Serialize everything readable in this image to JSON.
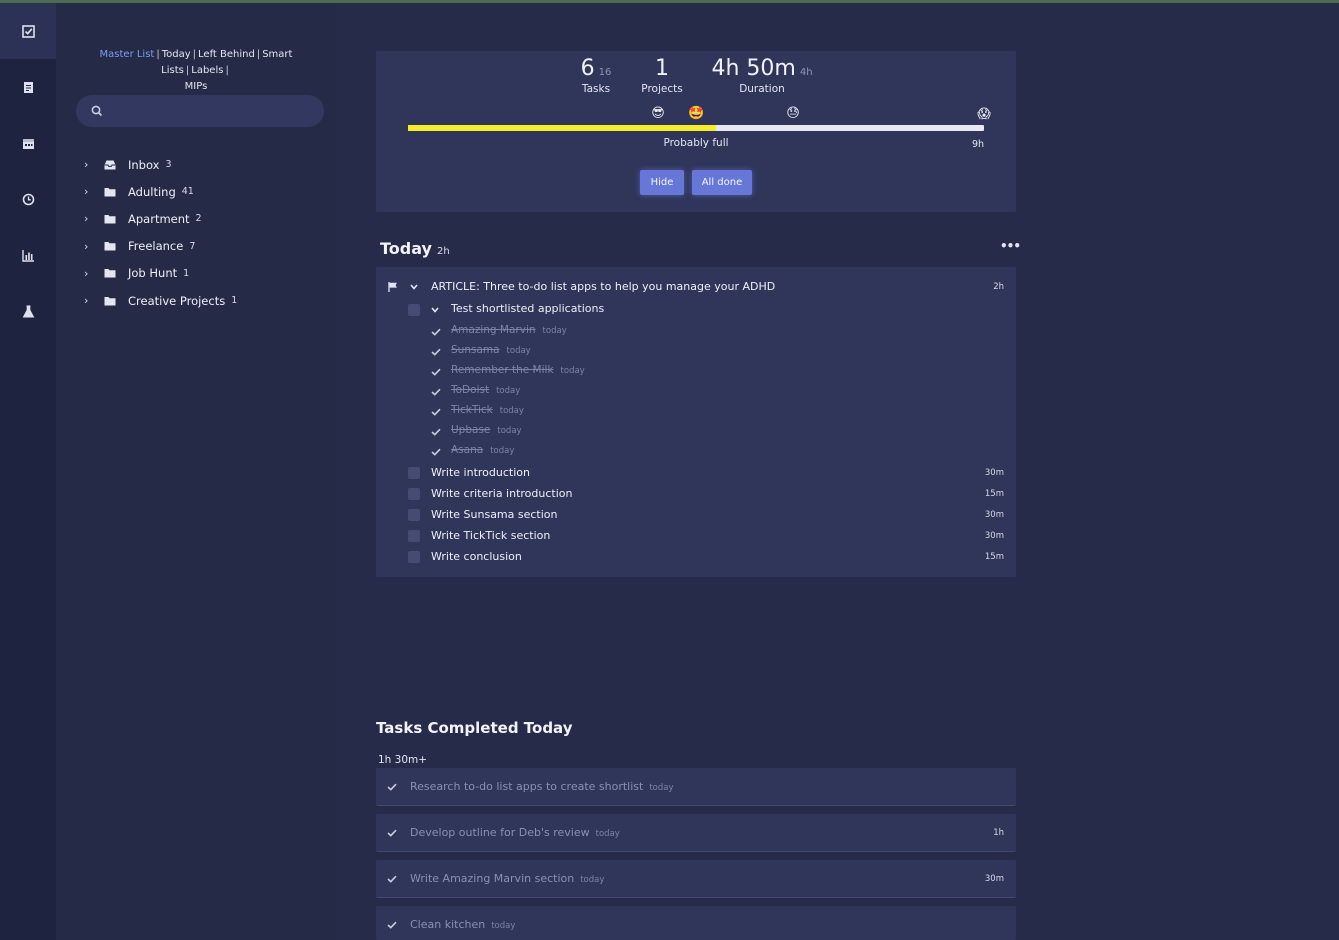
{
  "nav": {
    "links": [
      "Master List",
      "Today",
      "Left Behind",
      "Smart Lists",
      "Labels"
    ],
    "extra": "MIPs",
    "separator": "|"
  },
  "search": {
    "placeholder": ""
  },
  "folders": [
    {
      "name": "Inbox",
      "count": "3",
      "icon": "inbox-icon"
    },
    {
      "name": "Adulting",
      "count": "41",
      "icon": "folder-icon"
    },
    {
      "name": "Apartment",
      "count": "2",
      "icon": "folder-icon"
    },
    {
      "name": "Freelance",
      "count": "7",
      "icon": "folder-icon"
    },
    {
      "name": "Job Hunt",
      "count": "1",
      "icon": "folder-icon"
    },
    {
      "name": "Creative Projects",
      "count": "1",
      "icon": "folder-icon"
    }
  ],
  "summary": {
    "tasks_value": "6",
    "tasks_total": "16",
    "tasks_label": "Tasks",
    "projects_value": "1",
    "projects_label": "Projects",
    "duration_value": "4h 50m",
    "duration_extra": "4h",
    "duration_label": "Duration",
    "progress_fraction": 0.535,
    "capacity_label": "Probably full",
    "capacity_end": "9h",
    "hide_label": "Hide",
    "all_done_label": "All done",
    "emojis": [
      "😎",
      "🤩",
      "😓",
      "😱"
    ]
  },
  "today": {
    "title": "Today",
    "duration": "2h",
    "more": "•••",
    "project": {
      "title": "ARTICLE: Three to-do list apps to help you manage your ADHD",
      "time": "2h"
    },
    "subgroup": "Test shortlisted applications",
    "done_items": [
      {
        "text": "Amazing Marvin",
        "tag": "today"
      },
      {
        "text": "Sunsama",
        "tag": "today"
      },
      {
        "text": "Remember the Milk",
        "tag": "today"
      },
      {
        "text": "ToDoist",
        "tag": "today"
      },
      {
        "text": "TickTick",
        "tag": "today"
      },
      {
        "text": "Upbase",
        "tag": "today"
      },
      {
        "text": "Asana",
        "tag": "today"
      }
    ],
    "tasks": [
      {
        "text": "Write introduction",
        "time": "30m"
      },
      {
        "text": "Write criteria introduction",
        "time": "15m"
      },
      {
        "text": "Write Sunsama section",
        "time": "30m"
      },
      {
        "text": "Write TickTick section",
        "time": "30m"
      },
      {
        "text": "Write conclusion",
        "time": "15m"
      }
    ]
  },
  "completed": {
    "title": "Tasks Completed Today",
    "total": "1h 30m+",
    "items": [
      {
        "text": "Research to-do list apps to create shortlist",
        "tag": "today",
        "time": ""
      },
      {
        "text": "Develop outline for Deb's review",
        "tag": "today",
        "time": "1h"
      },
      {
        "text": "Write Amazing Marvin section",
        "tag": "today",
        "time": "30m"
      },
      {
        "text": "Clean kitchen",
        "tag": "today",
        "time": ""
      }
    ]
  },
  "colors": {
    "accent": "#6777d8",
    "progress": "#f5ec2c",
    "link_active": "#7f9cf0"
  }
}
